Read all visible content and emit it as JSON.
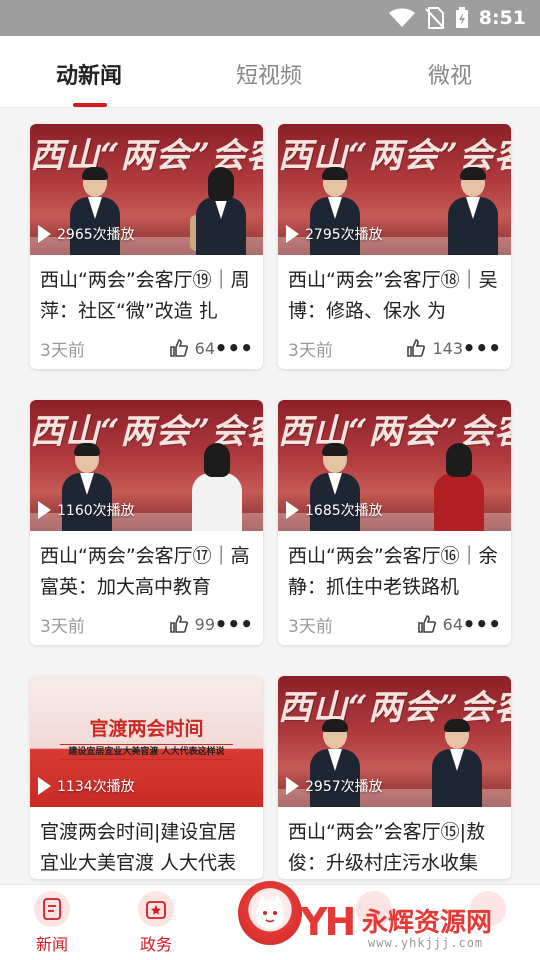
{
  "status_bar": {
    "time": "8:51"
  },
  "tabs": [
    {
      "label": "动新闻",
      "active": true
    },
    {
      "label": "短视频",
      "active": false
    },
    {
      "label": "微视",
      "active": false
    }
  ],
  "thumb_text": {
    "brush_title": "西山“两会”会客厅",
    "banner_title": "官渡两会时间",
    "banner_sub": "建设宜居宜业大美官渡 人大代表这样说"
  },
  "cards": [
    {
      "plays": "2965次播放",
      "title": "西山“两会”会客厅⑲｜周萍：社区“微”改造 扎",
      "age": "3天前",
      "likes": "64"
    },
    {
      "plays": "2795次播放",
      "title": "西山“两会”会客厅⑱｜吴博：修路、保水 为",
      "age": "3天前",
      "likes": "143"
    },
    {
      "plays": "1160次播放",
      "title": "西山“两会”会客厅⑰｜高富英：加大高中教育",
      "age": "3天前",
      "likes": "99"
    },
    {
      "plays": "1685次播放",
      "title": "西山“两会”会客厅⑯｜余静：抓住中老铁路机",
      "age": "3天前",
      "likes": "64"
    },
    {
      "plays": "1134次播放",
      "title": "官渡两会时间|建设宜居宜业大美官渡 人大代表",
      "age": "",
      "likes": ""
    },
    {
      "plays": "2957次播放",
      "title": "西山“两会”会客厅⑮|敖俊：升级村庄污水收集",
      "age": "",
      "likes": ""
    }
  ],
  "bottom_nav": [
    {
      "label": "新闻",
      "icon": "news-icon"
    },
    {
      "label": "政务",
      "icon": "gov-icon"
    }
  ],
  "watermark": {
    "logo": "YH",
    "text": "永辉资源网",
    "url": "www.yhkjjj.com"
  },
  "colors": {
    "accent": "#d7191e",
    "status_bar": "#9e9e9e"
  }
}
